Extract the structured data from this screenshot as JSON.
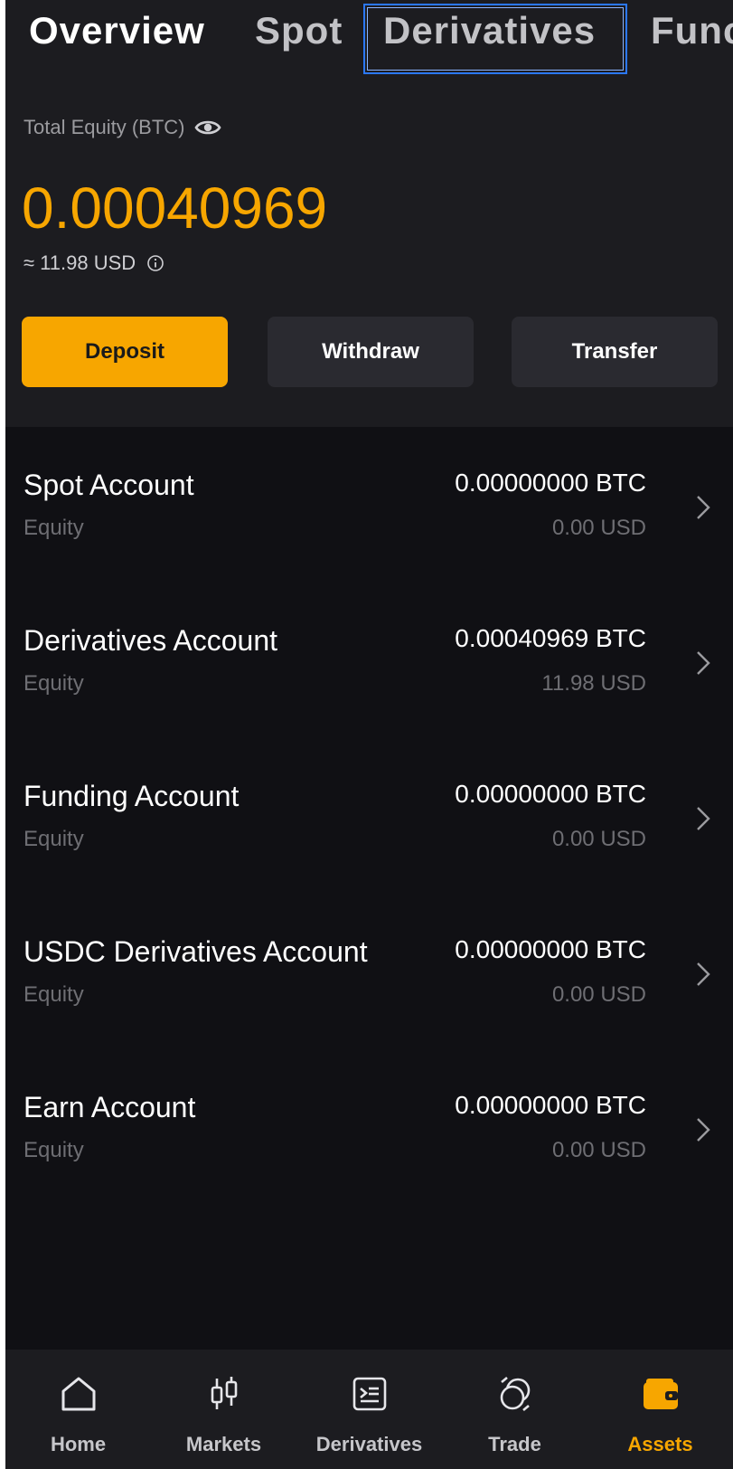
{
  "tabs": [
    {
      "label": "Overview",
      "active": true
    },
    {
      "label": "Spot",
      "active": false
    },
    {
      "label": "Derivatives",
      "active": false,
      "highlighted": true
    },
    {
      "label": "Func",
      "active": false
    }
  ],
  "summary": {
    "equity_label": "Total Equity (BTC)",
    "equity_value": "0.00040969",
    "usd_equivalent": "≈ 11.98 USD"
  },
  "actions": {
    "deposit": "Deposit",
    "withdraw": "Withdraw",
    "transfer": "Transfer"
  },
  "accounts": [
    {
      "name": "Spot Account",
      "sub": "Equity",
      "btc": "0.00000000 BTC",
      "usd": "0.00 USD"
    },
    {
      "name": "Derivatives Account",
      "sub": "Equity",
      "btc": "0.00040969 BTC",
      "usd": "11.98 USD"
    },
    {
      "name": "Funding Account",
      "sub": "Equity",
      "btc": "0.00000000 BTC",
      "usd": "0.00 USD"
    },
    {
      "name": "USDC Derivatives Account",
      "sub": "Equity",
      "btc": "0.00000000 BTC",
      "usd": "0.00 USD"
    },
    {
      "name": "Earn Account",
      "sub": "Equity",
      "btc": "0.00000000 BTC",
      "usd": "0.00 USD"
    }
  ],
  "nav": [
    {
      "label": "Home",
      "icon": "home-icon",
      "active": false
    },
    {
      "label": "Markets",
      "icon": "candlestick-icon",
      "active": false
    },
    {
      "label": "Derivatives",
      "icon": "derivatives-icon",
      "active": false
    },
    {
      "label": "Trade",
      "icon": "trade-icon",
      "active": false
    },
    {
      "label": "Assets",
      "icon": "wallet-icon",
      "active": true
    }
  ],
  "colors": {
    "accent": "#f7a600",
    "background": "#101014",
    "panel": "#1c1c20",
    "highlight_border": "#2b78ff"
  }
}
